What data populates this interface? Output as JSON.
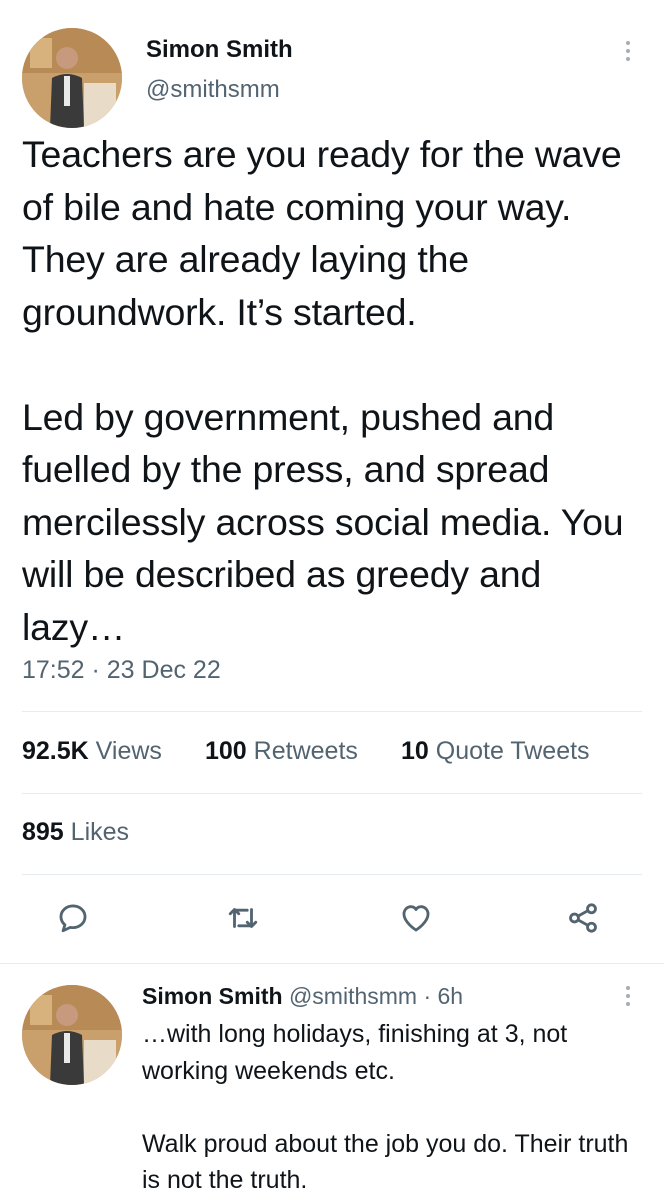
{
  "tweet": {
    "author_name": "Simon Smith",
    "author_handle": "@smithsmm",
    "text": "Teachers are you ready for the wave of bile and hate coming your way. They are already laying the groundwork. It’s started.\n\nLed by government, pushed and fuelled by the press, and spread mercilessly across social media. You will be described as greedy and lazy…",
    "timestamp": "17:52 · 23 Dec 22",
    "stats": {
      "views_count": "92.5K",
      "views_label": "Views",
      "retweets_count": "100",
      "retweets_label": "Retweets",
      "quotes_count": "10",
      "quotes_label": "Quote Tweets",
      "likes_count": "895",
      "likes_label": "Likes"
    },
    "actions": [
      "reply-icon",
      "retweet-icon",
      "like-icon",
      "share-icon"
    ]
  },
  "reply": {
    "author_name": "Simon Smith",
    "author_handle": "@smithsmm",
    "time": "· 6h",
    "text": "…with long holidays, finishing at 3, not working weekends etc.\n\nWalk proud about the job you do. Their truth is not the truth."
  },
  "colors": {
    "text_primary": "#0f1419",
    "text_secondary": "#536471",
    "divider": "#e6ebef",
    "icon": "#536471"
  }
}
